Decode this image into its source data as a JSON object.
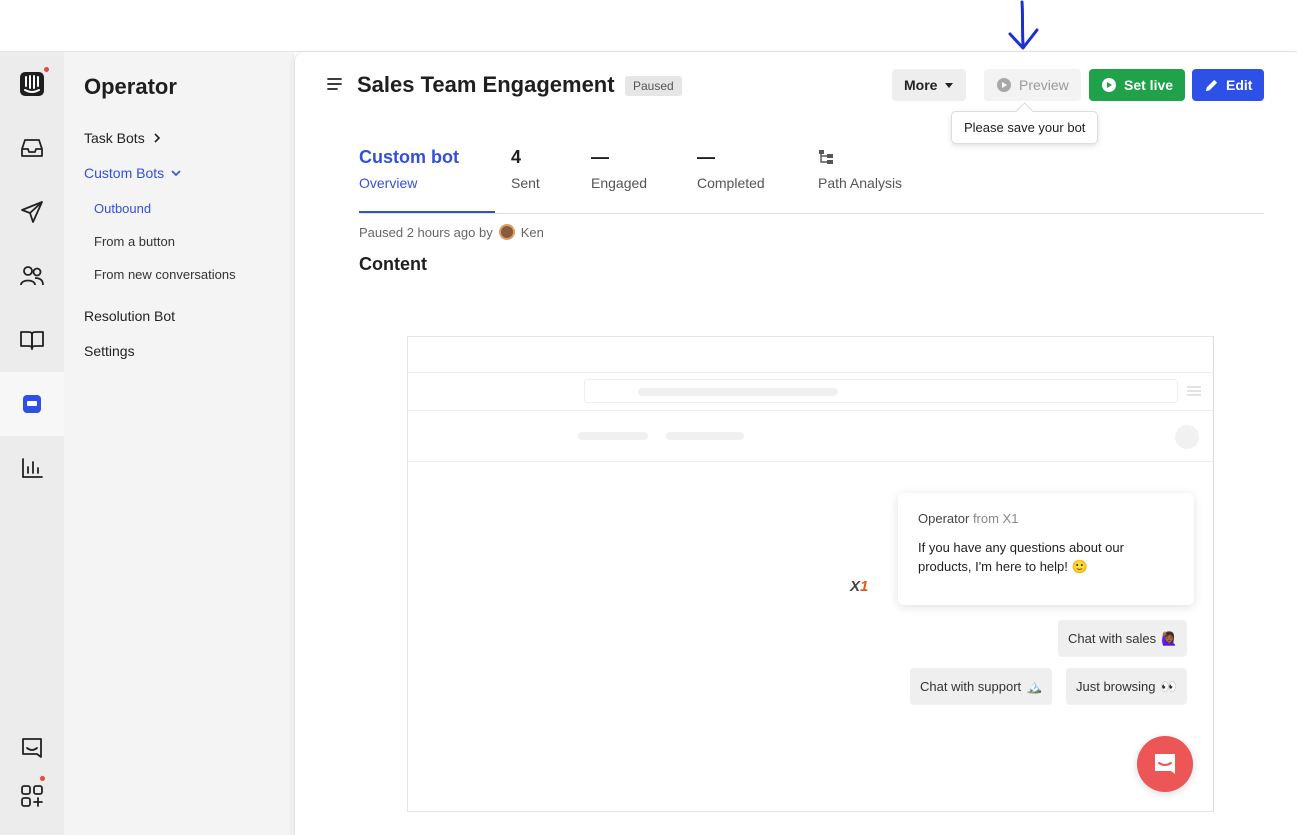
{
  "app": {
    "section_title": "Operator"
  },
  "sidebar": {
    "items": [
      {
        "label": "Task Bots"
      },
      {
        "label": "Custom Bots"
      },
      {
        "label": "Resolution Bot"
      },
      {
        "label": "Settings"
      }
    ],
    "custom_bots_children": [
      {
        "label": "Outbound"
      },
      {
        "label": "From a button"
      },
      {
        "label": "From new conversations"
      }
    ]
  },
  "header": {
    "title": "Sales Team Engagement",
    "status_badge": "Paused",
    "more_label": "More",
    "preview_label": "Preview",
    "set_live_label": "Set live",
    "edit_label": "Edit",
    "tooltip": "Please save your bot"
  },
  "tabs": [
    {
      "value": "Custom bot",
      "label": "Overview"
    },
    {
      "value": "4",
      "label": "Sent"
    },
    {
      "value": "—",
      "label": "Engaged"
    },
    {
      "value": "—",
      "label": "Completed"
    },
    {
      "value": "",
      "label": "Path Analysis"
    }
  ],
  "meta": {
    "paused_text": "Paused 2 hours ago by",
    "user": "Ken"
  },
  "content": {
    "heading": "Content",
    "message": {
      "sender": "Operator",
      "sender_suffix": "from X1",
      "text": "If you have any questions about our products, I'm here to help! 🙂",
      "brand_logo": "X1"
    },
    "replies": [
      {
        "label": "Chat with sales",
        "emoji": "🙋🏾‍♀️"
      },
      {
        "label": "Chat with support",
        "emoji": "🏔️"
      },
      {
        "label": "Just browsing",
        "emoji": "👀"
      }
    ]
  },
  "colors": {
    "accent": "#3450d9",
    "live_green": "#1fa24a",
    "edit_blue": "#2d50e6",
    "launcher_red": "#ec5656"
  }
}
